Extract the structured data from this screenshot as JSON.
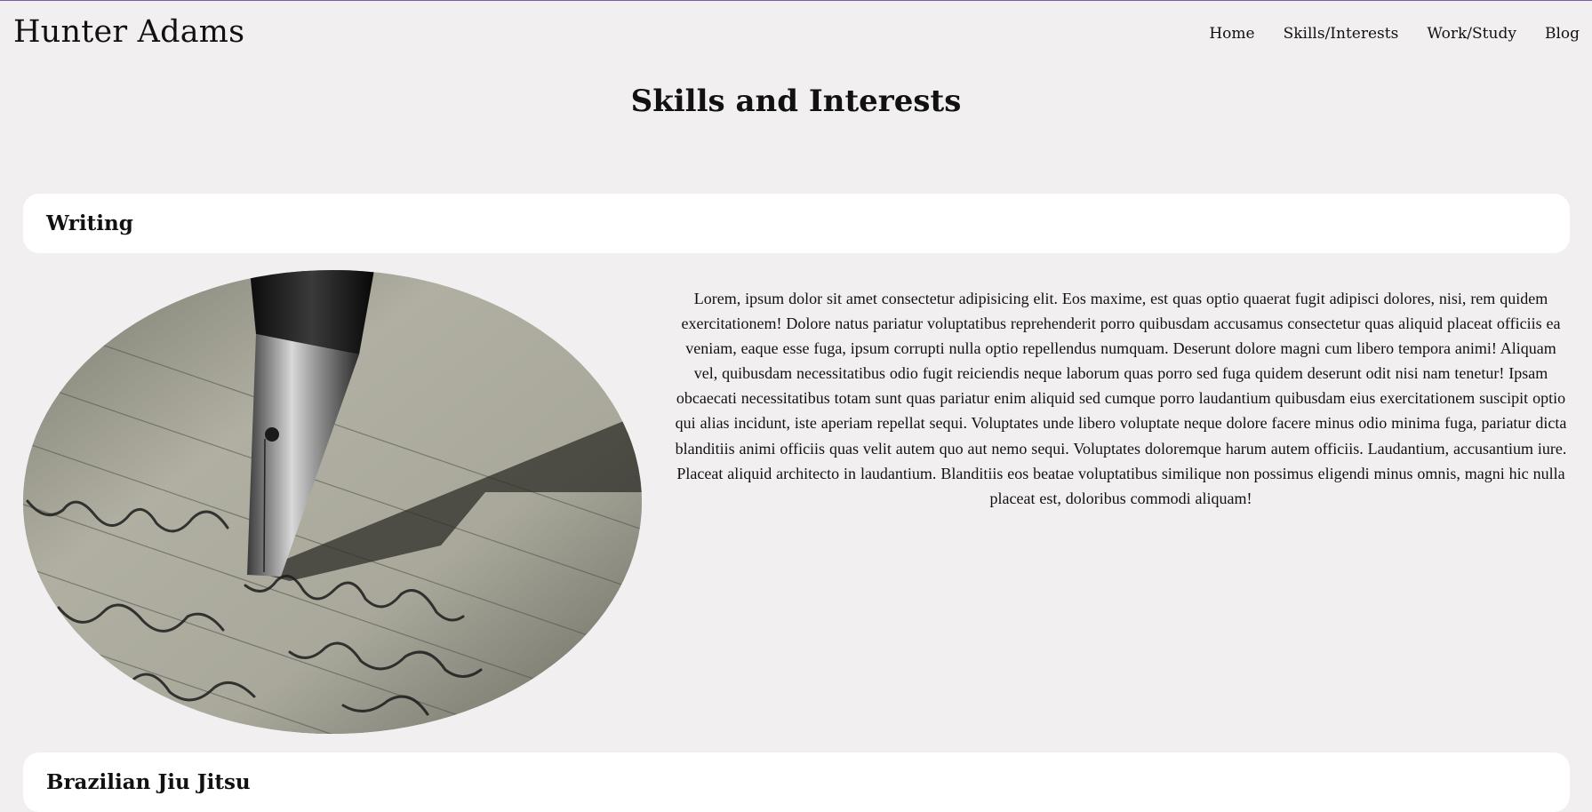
{
  "header": {
    "brand": "Hunter Adams",
    "nav": [
      {
        "label": "Home"
      },
      {
        "label": "Skills/Interests"
      },
      {
        "label": "Work/Study"
      },
      {
        "label": "Blog"
      }
    ]
  },
  "page": {
    "title": "Skills and Interests"
  },
  "sections": [
    {
      "heading": "Writing",
      "image_subject": "fountain pen nib writing cursive on lined paper",
      "body": "Lorem, ipsum dolor sit amet consectetur adipisicing elit. Eos maxime, est quas optio quaerat fugit adipisci dolores, nisi, rem quidem exercitationem! Dolore natus pariatur voluptatibus reprehenderit porro quibusdam accusamus consectetur quas aliquid placeat officiis ea veniam, eaque esse fuga, ipsum corrupti nulla optio repellendus numquam. Deserunt dolore magni cum libero tempora animi! Aliquam vel, quibusdam necessitatibus odio fugit reiciendis neque laborum quas porro sed fuga quidem deserunt odit nisi nam tenetur! Ipsam obcaecati necessitatibus totam sunt quas pariatur enim aliquid sed cumque porro laudantium quibusdam eius exercitationem suscipit optio qui alias incidunt, iste aperiam repellat sequi. Voluptates unde libero voluptate neque dolore facere minus odio minima fuga, pariatur dicta blanditiis animi officiis quas velit autem quo aut nemo sequi. Voluptates doloremque harum autem officiis. Laudantium, accusantium iure. Placeat aliquid architecto in laudantium. Blanditiis eos beatae voluptatibus similique non possimus eligendi minus omnis, magni hic nulla placeat est, doloribus commodi aliquam!"
    },
    {
      "heading": "Brazilian Jiu Jitsu"
    }
  ],
  "colors": {
    "background": "#f2eff1",
    "card": "#ffffff",
    "accent_line": "#7b5ea7"
  }
}
